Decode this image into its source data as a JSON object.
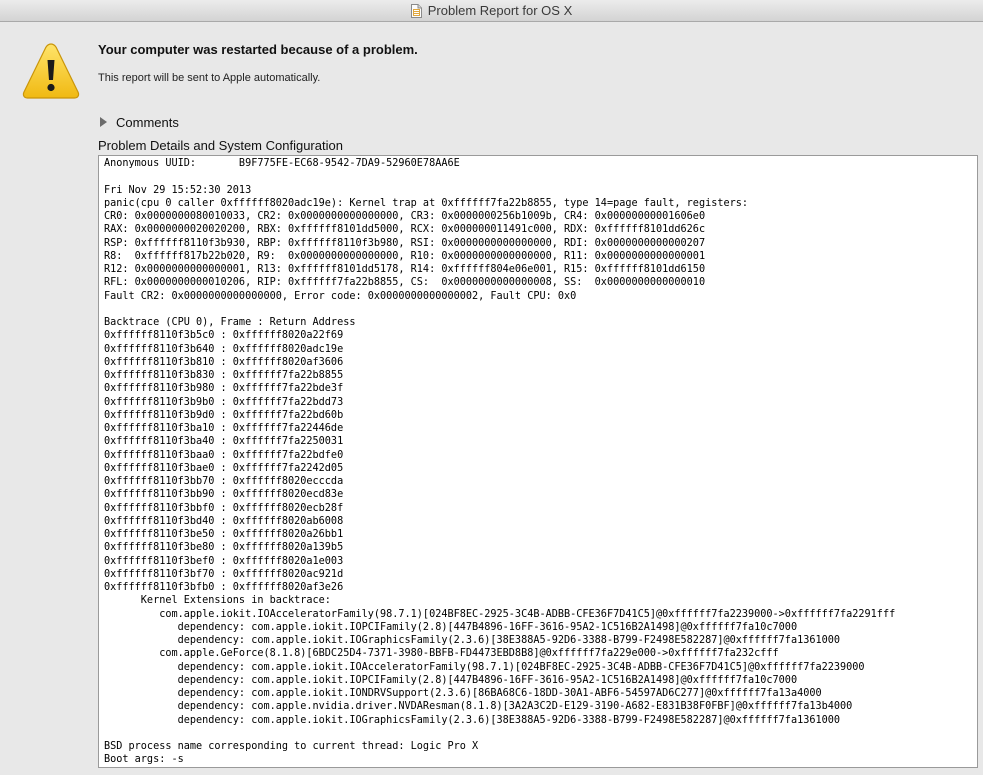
{
  "window": {
    "title": "Problem Report for OS X",
    "icon": "document-icon"
  },
  "alert": {
    "icon": "warning-icon",
    "accent_color": "#f5c518",
    "headline": "Your computer was restarted because of a problem.",
    "message": "This report will be sent to Apple automatically."
  },
  "comments": {
    "label": "Comments"
  },
  "details": {
    "heading": "Problem Details and System Configuration",
    "report": "Anonymous UUID:       B9F775FE-EC68-9542-7DA9-52960E78AA6E\n\nFri Nov 29 15:52:30 2013\npanic(cpu 0 caller 0xffffff8020adc19e): Kernel trap at 0xffffff7fa22b8855, type 14=page fault, registers:\nCR0: 0x0000000080010033, CR2: 0x0000000000000000, CR3: 0x0000000256b1009b, CR4: 0x00000000001606e0\nRAX: 0x0000000020020200, RBX: 0xffffff8101dd5000, RCX: 0x000000011491c000, RDX: 0xffffff8101dd626c\nRSP: 0xffffff8110f3b930, RBP: 0xffffff8110f3b980, RSI: 0x0000000000000000, RDI: 0x0000000000000207\nR8:  0xffffff817b22b020, R9:  0x0000000000000000, R10: 0x0000000000000000, R11: 0x0000000000000001\nR12: 0x0000000000000001, R13: 0xffffff8101dd5178, R14: 0xffffff804e06e001, R15: 0xffffff8101dd6150\nRFL: 0x0000000000010206, RIP: 0xffffff7fa22b8855, CS:  0x0000000000000008, SS:  0x0000000000000010\nFault CR2: 0x0000000000000000, Error code: 0x0000000000000002, Fault CPU: 0x0\n\nBacktrace (CPU 0), Frame : Return Address\n0xffffff8110f3b5c0 : 0xffffff8020a22f69\n0xffffff8110f3b640 : 0xffffff8020adc19e\n0xffffff8110f3b810 : 0xffffff8020af3606\n0xffffff8110f3b830 : 0xffffff7fa22b8855\n0xffffff8110f3b980 : 0xffffff7fa22bde3f\n0xffffff8110f3b9b0 : 0xffffff7fa22bdd73\n0xffffff8110f3b9d0 : 0xffffff7fa22bd60b\n0xffffff8110f3ba10 : 0xffffff7fa22446de\n0xffffff8110f3ba40 : 0xffffff7fa2250031\n0xffffff8110f3baa0 : 0xffffff7fa22bdfe0\n0xffffff8110f3bae0 : 0xffffff7fa2242d05\n0xffffff8110f3bb70 : 0xffffff8020ecccda\n0xffffff8110f3bb90 : 0xffffff8020ecd83e\n0xffffff8110f3bbf0 : 0xffffff8020ecb28f\n0xffffff8110f3bd40 : 0xffffff8020ab6008\n0xffffff8110f3be50 : 0xffffff8020a26bb1\n0xffffff8110f3be80 : 0xffffff8020a139b5\n0xffffff8110f3bef0 : 0xffffff8020a1e003\n0xffffff8110f3bf70 : 0xffffff8020ac921d\n0xffffff8110f3bfb0 : 0xffffff8020af3e26\n      Kernel Extensions in backtrace:\n         com.apple.iokit.IOAcceleratorFamily(98.7.1)[024BF8EC-2925-3C4B-ADBB-CFE36F7D41C5]@0xffffff7fa2239000->0xffffff7fa2291fff\n            dependency: com.apple.iokit.IOPCIFamily(2.8)[447B4896-16FF-3616-95A2-1C516B2A1498]@0xffffff7fa10c7000\n            dependency: com.apple.iokit.IOGraphicsFamily(2.3.6)[38E388A5-92D6-3388-B799-F2498E582287]@0xffffff7fa1361000\n         com.apple.GeForce(8.1.8)[6BDC25D4-7371-3980-BBFB-FD4473EBD8B8]@0xffffff7fa229e000->0xffffff7fa232cfff\n            dependency: com.apple.iokit.IOAcceleratorFamily(98.7.1)[024BF8EC-2925-3C4B-ADBB-CFE36F7D41C5]@0xffffff7fa2239000\n            dependency: com.apple.iokit.IOPCIFamily(2.8)[447B4896-16FF-3616-95A2-1C516B2A1498]@0xffffff7fa10c7000\n            dependency: com.apple.iokit.IONDRVSupport(2.3.6)[86BA68C6-18DD-30A1-ABF6-54597AD6C277]@0xffffff7fa13a4000\n            dependency: com.apple.nvidia.driver.NVDAResman(8.1.8)[3A2A3C2D-E129-3190-A682-E831B38F0FBF]@0xffffff7fa13b4000\n            dependency: com.apple.iokit.IOGraphicsFamily(2.3.6)[38E388A5-92D6-3388-B799-F2498E582287]@0xffffff7fa1361000\n\nBSD process name corresponding to current thread: Logic Pro X\nBoot args: -s"
  }
}
